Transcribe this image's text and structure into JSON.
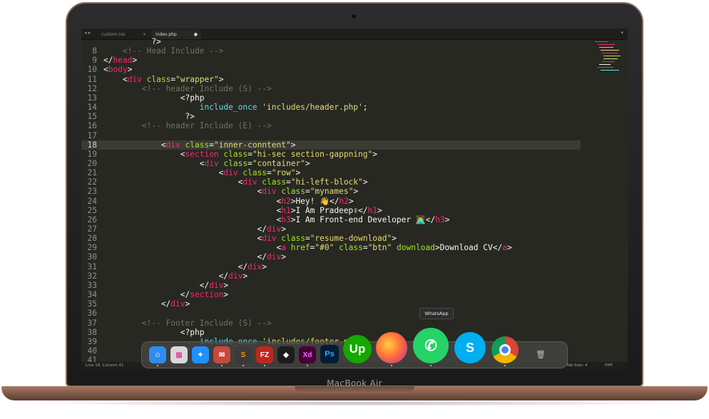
{
  "device": {
    "brand": "MacBook Air"
  },
  "tabs": [
    {
      "label": "custom.css",
      "close": "×"
    },
    {
      "label": "index.php",
      "close": "●"
    }
  ],
  "tab_nav": "◂ ▸",
  "tab_menu": "▾",
  "editor": {
    "lines": [
      {
        "n": "",
        "tokens": [
          [
            "          ?>",
            "code"
          ]
        ]
      },
      {
        "n": "8",
        "tokens": [
          [
            "    ",
            "code"
          ],
          [
            "<!-- Head Include -->",
            "cm"
          ]
        ]
      },
      {
        "n": "9",
        "tokens": [
          [
            "</",
            "code"
          ],
          [
            "head",
            "tg"
          ],
          [
            ">",
            "code"
          ]
        ]
      },
      {
        "n": "10",
        "tokens": [
          [
            "<",
            "code"
          ],
          [
            "body",
            "tg"
          ],
          [
            ">",
            "code"
          ]
        ]
      },
      {
        "n": "11",
        "tokens": [
          [
            "    <",
            "code"
          ],
          [
            "div",
            "tg"
          ],
          [
            " ",
            "code"
          ],
          [
            "class",
            "at"
          ],
          [
            "=",
            "code"
          ],
          [
            "\"wrapper\"",
            "st"
          ],
          [
            ">",
            "code"
          ]
        ]
      },
      {
        "n": "12",
        "tokens": [
          [
            "        ",
            "code"
          ],
          [
            "<!-- header Include (S) -->",
            "cm"
          ]
        ]
      },
      {
        "n": "13",
        "tokens": [
          [
            "                <?php",
            "code"
          ]
        ]
      },
      {
        "n": "14",
        "tokens": [
          [
            "                    ",
            "code"
          ],
          [
            "include_once",
            "fn"
          ],
          [
            " ",
            "code"
          ],
          [
            "'includes/header.php'",
            "st"
          ],
          [
            ";",
            "code"
          ]
        ]
      },
      {
        "n": "15",
        "tokens": [
          [
            "                 ?>",
            "code"
          ]
        ]
      },
      {
        "n": "16",
        "tokens": [
          [
            "        ",
            "code"
          ],
          [
            "<!-- header Include (E) -->",
            "cm"
          ]
        ]
      },
      {
        "n": "17",
        "tokens": [
          [
            "",
            "code"
          ]
        ]
      },
      {
        "n": "18",
        "hl": true,
        "tokens": [
          [
            "            <",
            "code"
          ],
          [
            "div",
            "tg"
          ],
          [
            " ",
            "code"
          ],
          [
            "class",
            "at"
          ],
          [
            "=",
            "code"
          ],
          [
            "\"inner-conntent\"",
            "st"
          ],
          [
            ">",
            "code"
          ]
        ]
      },
      {
        "n": "19",
        "tokens": [
          [
            "                <",
            "code"
          ],
          [
            "section",
            "tg"
          ],
          [
            " ",
            "code"
          ],
          [
            "class",
            "at"
          ],
          [
            "=",
            "code"
          ],
          [
            "\"hi-sec section-gappning\"",
            "st"
          ],
          [
            ">",
            "code"
          ]
        ]
      },
      {
        "n": "20",
        "tokens": [
          [
            "                    <",
            "code"
          ],
          [
            "div",
            "tg"
          ],
          [
            " ",
            "code"
          ],
          [
            "class",
            "at"
          ],
          [
            "=",
            "code"
          ],
          [
            "\"container\"",
            "st"
          ],
          [
            ">",
            "code"
          ]
        ]
      },
      {
        "n": "21",
        "tokens": [
          [
            "                        <",
            "code"
          ],
          [
            "div",
            "tg"
          ],
          [
            " ",
            "code"
          ],
          [
            "class",
            "at"
          ],
          [
            "=",
            "code"
          ],
          [
            "\"row\"",
            "st"
          ],
          [
            ">",
            "code"
          ]
        ]
      },
      {
        "n": "22",
        "tokens": [
          [
            "                            <",
            "code"
          ],
          [
            "div",
            "tg"
          ],
          [
            " ",
            "code"
          ],
          [
            "class",
            "at"
          ],
          [
            "=",
            "code"
          ],
          [
            "\"hi-left-block\"",
            "st"
          ],
          [
            ">",
            "code"
          ]
        ]
      },
      {
        "n": "23",
        "tokens": [
          [
            "                                <",
            "code"
          ],
          [
            "div",
            "tg"
          ],
          [
            " ",
            "code"
          ],
          [
            "class",
            "at"
          ],
          [
            "=",
            "code"
          ],
          [
            "\"mynames\"",
            "st"
          ],
          [
            ">",
            "code"
          ]
        ]
      },
      {
        "n": "24",
        "tokens": [
          [
            "                                    <",
            "code"
          ],
          [
            "h2",
            "tg"
          ],
          [
            ">Hey! 👋</",
            "code"
          ],
          [
            "h2",
            "tg"
          ],
          [
            ">",
            "code"
          ]
        ]
      },
      {
        "n": "25",
        "tokens": [
          [
            "                                    <",
            "code"
          ],
          [
            "h1",
            "tg"
          ],
          [
            ">I Am Pradeep✌</",
            "code"
          ],
          [
            "h1",
            "tg"
          ],
          [
            ">",
            "code"
          ]
        ]
      },
      {
        "n": "26",
        "tokens": [
          [
            "                                    <",
            "code"
          ],
          [
            "h3",
            "tg"
          ],
          [
            ">I Am Front-end Developer 👨‍💻</",
            "code"
          ],
          [
            "h3",
            "tg"
          ],
          [
            ">",
            "code"
          ]
        ]
      },
      {
        "n": "27",
        "tokens": [
          [
            "                                </",
            "code"
          ],
          [
            "div",
            "tg"
          ],
          [
            ">",
            "code"
          ]
        ]
      },
      {
        "n": "28",
        "tokens": [
          [
            "                                <",
            "code"
          ],
          [
            "div",
            "tg"
          ],
          [
            " ",
            "code"
          ],
          [
            "class",
            "at"
          ],
          [
            "=",
            "code"
          ],
          [
            "\"resume-download\"",
            "st"
          ],
          [
            ">",
            "code"
          ]
        ]
      },
      {
        "n": "29",
        "tokens": [
          [
            "                                    <",
            "code"
          ],
          [
            "a",
            "tg"
          ],
          [
            " ",
            "code"
          ],
          [
            "href",
            "at"
          ],
          [
            "=",
            "code"
          ],
          [
            "\"#0\"",
            "st"
          ],
          [
            " ",
            "code"
          ],
          [
            "class",
            "at"
          ],
          [
            "=",
            "code"
          ],
          [
            "\"btn\"",
            "st"
          ],
          [
            " ",
            "code"
          ],
          [
            "download",
            "at"
          ],
          [
            ">Download CV</",
            "code"
          ],
          [
            "a",
            "tg"
          ],
          [
            ">",
            "code"
          ]
        ]
      },
      {
        "n": "30",
        "tokens": [
          [
            "                                </",
            "code"
          ],
          [
            "div",
            "tg"
          ],
          [
            ">",
            "code"
          ]
        ]
      },
      {
        "n": "31",
        "tokens": [
          [
            "                            </",
            "code"
          ],
          [
            "div",
            "tg"
          ],
          [
            ">",
            "code"
          ]
        ]
      },
      {
        "n": "32",
        "tokens": [
          [
            "                        </",
            "code"
          ],
          [
            "div",
            "tg"
          ],
          [
            ">",
            "code"
          ]
        ]
      },
      {
        "n": "33",
        "tokens": [
          [
            "                    </",
            "code"
          ],
          [
            "div",
            "tg"
          ],
          [
            ">",
            "code"
          ]
        ]
      },
      {
        "n": "34",
        "tokens": [
          [
            "                </",
            "code"
          ],
          [
            "section",
            "tg"
          ],
          [
            ">",
            "code"
          ]
        ]
      },
      {
        "n": "35",
        "tokens": [
          [
            "            </",
            "code"
          ],
          [
            "div",
            "tg"
          ],
          [
            ">",
            "code"
          ]
        ]
      },
      {
        "n": "36",
        "tokens": [
          [
            "",
            "code"
          ]
        ]
      },
      {
        "n": "37",
        "tokens": [
          [
            "        ",
            "code"
          ],
          [
            "<!-- Footer Include (S) -->",
            "cm"
          ]
        ]
      },
      {
        "n": "38",
        "tokens": [
          [
            "                <?php",
            "code"
          ]
        ]
      },
      {
        "n": "39",
        "tokens": [
          [
            "                    ",
            "code"
          ],
          [
            "include_once",
            "fn"
          ],
          [
            " ",
            "code"
          ],
          [
            "'includes/footer.php'",
            "st"
          ],
          [
            ";",
            "code"
          ]
        ]
      },
      {
        "n": "40",
        "tokens": [
          [
            "",
            "code"
          ]
        ]
      },
      {
        "n": "41",
        "tokens": [
          [
            "",
            "code"
          ]
        ]
      }
    ]
  },
  "statusbar": {
    "position": "Line 18, Column 41",
    "tab_size": "Tab Size: 4",
    "syntax": "PHP"
  },
  "dock": {
    "tooltip": "WhatsApp",
    "apps": [
      {
        "name": "finder-icon",
        "glyph": "☺",
        "bg": "#2f8cf0"
      },
      {
        "name": "launchpad-icon",
        "glyph": "▦",
        "bg": "#d8d8dc"
      },
      {
        "name": "safari-icon",
        "glyph": "✦",
        "bg": "#1e90ff"
      },
      {
        "name": "mail-icon",
        "glyph": "✉",
        "bg": "#c8483c"
      },
      {
        "name": "sublime-text-icon",
        "glyph": "S",
        "bg": "#3a3a3a"
      },
      {
        "name": "filezilla-icon",
        "glyph": "FZ",
        "bg": "#c0261e"
      },
      {
        "name": "sketch-icon",
        "glyph": "◆",
        "bg": "#1c1c1c"
      },
      {
        "name": "adobe-xd-icon",
        "glyph": "Xd",
        "bg": "#470137"
      },
      {
        "name": "photoshop-icon",
        "glyph": "Ps",
        "bg": "#001e36"
      },
      {
        "name": "upwork-icon",
        "glyph": "Up",
        "bg": "#14a800"
      },
      {
        "name": "firefox-icon",
        "glyph": "",
        "bg": "#ff7139"
      },
      {
        "name": "whatsapp-icon",
        "glyph": "✆",
        "bg": "#25d366"
      },
      {
        "name": "skype-icon",
        "glyph": "S",
        "bg": "#00aff0"
      },
      {
        "name": "chrome-icon",
        "glyph": "",
        "bg": "#ffffff"
      },
      {
        "name": "trash-icon",
        "glyph": "🗑",
        "bg": "transparent"
      }
    ]
  },
  "colors": {
    "editor_bg": "#272822",
    "tag": "#f92672",
    "attr": "#a6e22e",
    "string": "#e6db74",
    "comment": "#75715e",
    "func": "#66d9ef"
  }
}
